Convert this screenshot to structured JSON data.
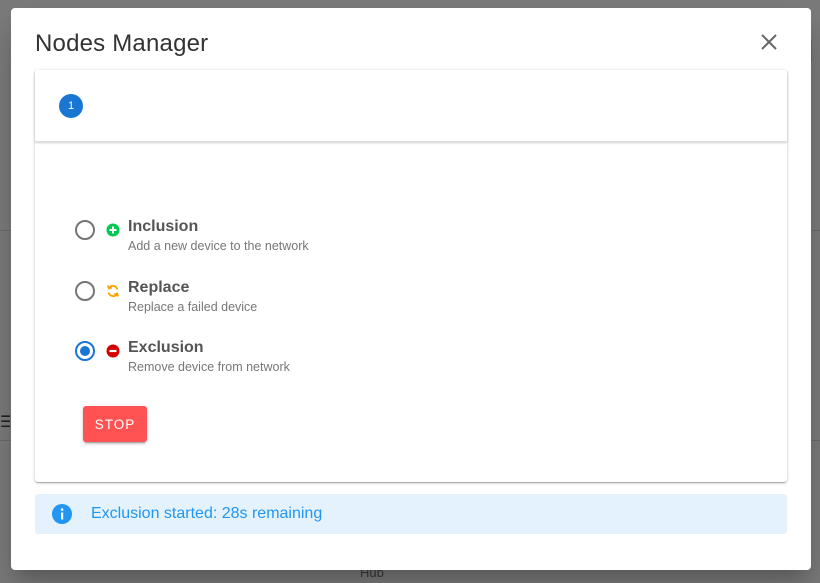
{
  "dialog": {
    "title": "Nodes Manager",
    "close_icon": "close-icon"
  },
  "stepper": {
    "step_number": "1"
  },
  "options": [
    {
      "title": "Inclusion",
      "subtitle": "Add a new device to the network",
      "icon": "plus-circle-icon",
      "icon_color": "#00c853",
      "selected": false
    },
    {
      "title": "Replace",
      "subtitle": "Replace a failed device",
      "icon": "refresh-icon",
      "icon_color": "#ffa000",
      "selected": false
    },
    {
      "title": "Exclusion",
      "subtitle": "Remove device from network",
      "icon": "minus-circle-icon",
      "icon_color": "#d50000",
      "selected": true
    }
  ],
  "actions": {
    "stop_label": "STOP"
  },
  "alert": {
    "icon": "info-icon",
    "text": "Exclusion started: 28s remaining"
  },
  "background": {
    "footer_text": "Hub"
  },
  "colors": {
    "primary": "#1976d2",
    "stop": "#ff5252",
    "alert_bg": "#e3f2fd",
    "alert_text": "#2196f3"
  }
}
